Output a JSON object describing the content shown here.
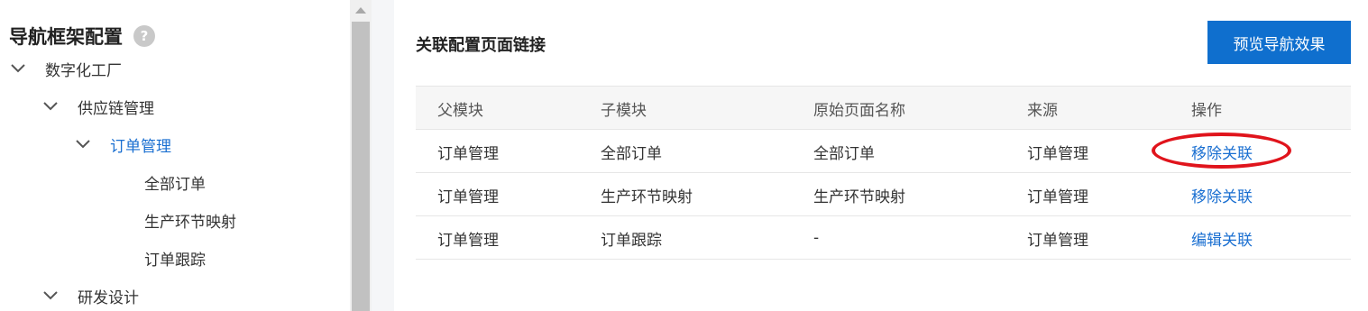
{
  "sidebar": {
    "title": "导航框架配置",
    "help_glyph": "?",
    "tree": [
      {
        "label": "数字化工厂",
        "expanded": true
      },
      {
        "label": "供应链管理",
        "expanded": true
      },
      {
        "label": "订单管理",
        "expanded": true,
        "active": true
      },
      {
        "label": "全部订单"
      },
      {
        "label": "生产环节映射"
      },
      {
        "label": "订单跟踪"
      },
      {
        "label": "研发设计",
        "expanded": true
      }
    ]
  },
  "main": {
    "title": "关联配置页面链接",
    "preview_button": "预览导航效果",
    "table": {
      "headers": [
        "父模块",
        "子模块",
        "原始页面名称",
        "来源",
        "操作"
      ],
      "rows": [
        {
          "parent": "订单管理",
          "child": "全部订单",
          "original": "全部订单",
          "source": "订单管理",
          "action": "移除关联"
        },
        {
          "parent": "订单管理",
          "child": "生产环节映射",
          "original": "生产环节映射",
          "source": "订单管理",
          "action": "移除关联"
        },
        {
          "parent": "订单管理",
          "child": "订单跟踪",
          "original": "-",
          "source": "订单管理",
          "action": "编辑关联"
        }
      ]
    }
  },
  "colors": {
    "accent": "#0f6fce",
    "link": "#1a6fd1",
    "annotation": "#e0141c"
  }
}
